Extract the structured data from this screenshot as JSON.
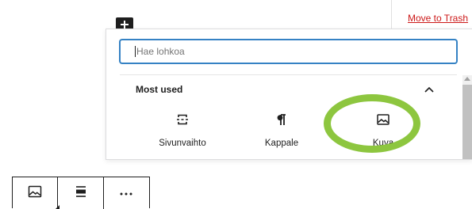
{
  "sidebar": {
    "trash_link": "Move to Trash"
  },
  "inserter": {
    "add_toggle_icon": "plus-icon",
    "search": {
      "placeholder": "Hae lohkoa",
      "value": ""
    },
    "panel": {
      "title": "Most used",
      "toggle_icon": "chevron-up-icon"
    },
    "blocks": [
      {
        "label": "Sivunvaihto",
        "icon": "page-break-icon"
      },
      {
        "label": "Kappale",
        "icon": "paragraph-icon"
      },
      {
        "label": "Kuva",
        "icon": "image-icon"
      }
    ]
  },
  "annotation": {
    "ring_color": "#8dc63f"
  },
  "block_toolbar": {
    "buttons": [
      {
        "icon": "image-icon"
      },
      {
        "icon": "align-icon"
      },
      {
        "icon": "more-options-icon"
      }
    ]
  }
}
